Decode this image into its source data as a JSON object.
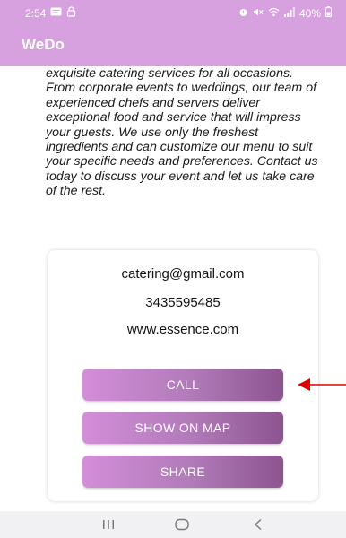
{
  "status_bar": {
    "time": "2:54",
    "battery": "40%"
  },
  "app_bar": {
    "title": "WeDo"
  },
  "content": {
    "description": "exquisite catering services for all occasions. From corporate events to weddings, our team of experienced chefs and servers deliver exceptional food and service that will impress your guests. We use only the freshest ingredients and can customize our menu to suit your specific needs and preferences. Contact us today to discuss your event and let us take care of the rest."
  },
  "contact": {
    "email": "catering@gmail.com",
    "phone": "3435595485",
    "website": "www.essence.com"
  },
  "actions": {
    "call_label": "CALL",
    "map_label": "SHOW ON MAP",
    "share_label": "SHARE"
  },
  "icons": {
    "status_left": [
      "sms-icon",
      "lock-icon"
    ],
    "status_right": [
      "alarm-icon",
      "mute-icon",
      "wifi-icon",
      "signal-icon",
      "battery-icon"
    ],
    "annotation": "red-arrow-icon",
    "nav": [
      "recents-icon",
      "home-icon",
      "back-icon"
    ]
  },
  "colors": {
    "app_bar": "#d7a0df",
    "button_start": "#d38ed8",
    "button_end": "#8c5590",
    "annotation_arrow": "#e00000",
    "nav_bar": "#f1f1f3"
  }
}
